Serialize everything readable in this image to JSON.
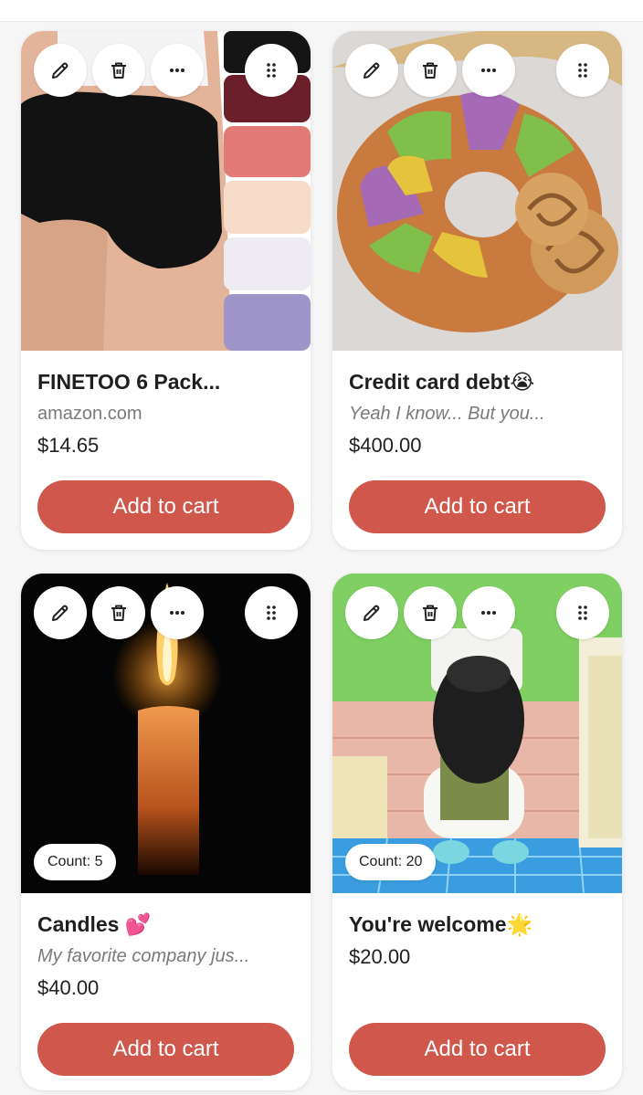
{
  "colors": {
    "cart_button": "#d0574b",
    "cart_button_text": "#ffffff",
    "page_background": "#f6f6f7",
    "card_background": "#ffffff",
    "subtitle_text": "#7a7a7a"
  },
  "card_actions": {
    "edit_icon": "pencil-icon",
    "delete_icon": "trash-icon",
    "more_icon": "ellipsis-icon",
    "drag_icon": "drag-handle-icon"
  },
  "items": [
    {
      "title": "FINETOO 6 Pack...",
      "title_emoji": "",
      "subtitle": "amazon.com",
      "subtitle_italic": false,
      "price": "$14.65",
      "count": "",
      "cart_label": "Add to cart",
      "image": "Black seamless briefs on a model beside a stack of colored underwear"
    },
    {
      "title": "Credit card debt",
      "title_emoji": "😭",
      "subtitle": "Yeah I know... But you...",
      "subtitle_italic": true,
      "price": "$400.00",
      "count": "",
      "cart_label": "Add to cart",
      "image": "King cake with purple, green and gold sugar"
    },
    {
      "title": "Candles ",
      "title_emoji": "💕",
      "subtitle": "My favorite company jus...",
      "subtitle_italic": true,
      "price": "$40.00",
      "count": "Count: 5",
      "cart_label": "Add to cart",
      "image": "Lit orange candle on black background"
    },
    {
      "title": "You're welcome",
      "title_emoji": "🌟",
      "subtitle": "",
      "subtitle_italic": false,
      "price": "$20.00",
      "count": "Count: 20",
      "cart_label": "Add to cart",
      "image": "Cartoon character in a cap kneeling at a toilet in a green bathroom"
    }
  ]
}
